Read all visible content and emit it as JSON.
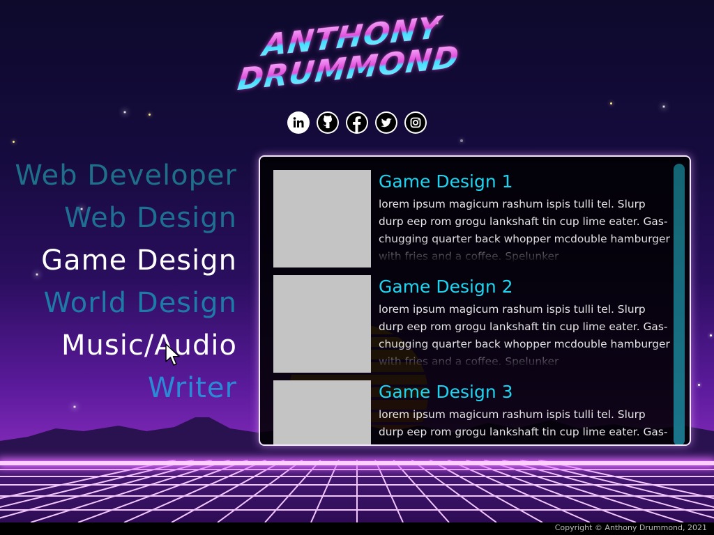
{
  "logo": {
    "line1": "ANTHONY",
    "line2": "DRUMMOND"
  },
  "social": [
    {
      "name": "linkedin-icon"
    },
    {
      "name": "github-icon"
    },
    {
      "name": "facebook-icon"
    },
    {
      "name": "twitter-icon"
    },
    {
      "name": "instagram-icon"
    }
  ],
  "nav": {
    "items": [
      {
        "label": "Web Developer",
        "color": "#1f6f8a"
      },
      {
        "label": "Web Design",
        "color": "#1e6f92"
      },
      {
        "label": "Game Design",
        "color": "#ffffff"
      },
      {
        "label": "World Design",
        "color": "#1e7aa6"
      },
      {
        "label": "Music/Audio",
        "color": "#ffffff"
      },
      {
        "label": "Writer",
        "color": "#2a8ad6"
      }
    ]
  },
  "cards": [
    {
      "title": "Game Design 1",
      "text": "lorem ipsum magicum rashum ispis tulli tel. Slurp durp eep rom grogu lankshaft tin cup lime eater. Gas-chugging quarter back whopper mcdouble hamburger with fries and a coffee. Spelunker"
    },
    {
      "title": "Game Design 2",
      "text": "lorem ipsum magicum rashum ispis tulli tel. Slurp durp eep rom grogu lankshaft tin cup lime eater. Gas-chugging quarter back whopper mcdouble hamburger with fries and a coffee. Spelunker"
    },
    {
      "title": "Game Design 3",
      "text": "lorem ipsum magicum rashum ispis tulli tel. Slurp durp eep rom grogu lankshaft tin cup lime eater. Gas-chugging quarter back whopper mcdouble hamburger with fries and a coffee. Spelunker"
    }
  ],
  "footer": {
    "copyright": "Copyright © Anthony Drummond, 2021"
  },
  "colors": {
    "accent": "#1ed4f0",
    "panel_border": "#f3e6ff"
  }
}
